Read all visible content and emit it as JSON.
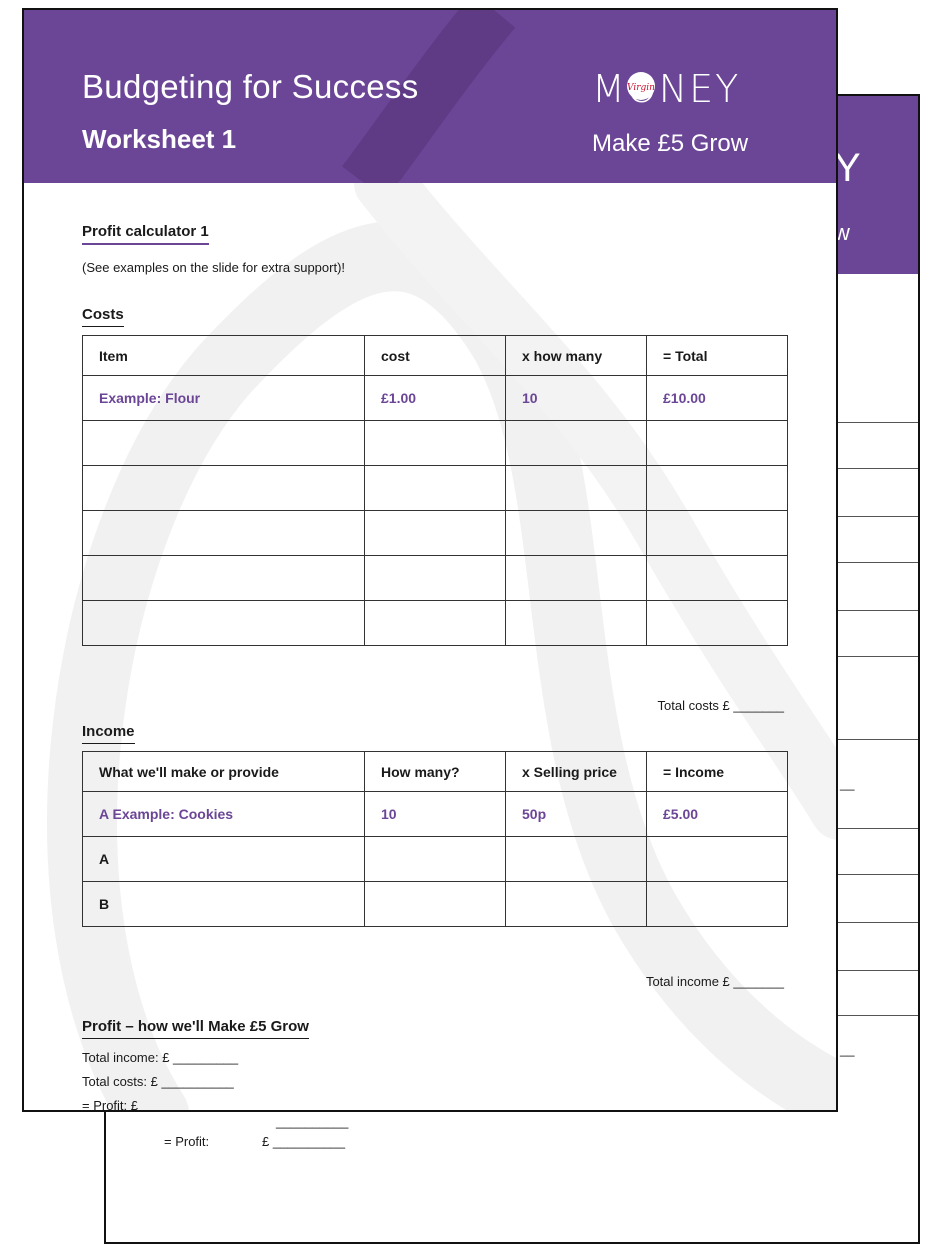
{
  "header": {
    "title": "Budgeting for Success",
    "subtitle": "Worksheet 1",
    "logo_text": "MONEY",
    "logo_badge": "Virgin",
    "tagline": "Make £5 Grow"
  },
  "back_page": {
    "logo_fragment": "Y",
    "tagline_fragment": "w",
    "profit_blank": "__________",
    "profit_label": "= Profit:",
    "profit_value": "£ __________",
    "dash_1": "__",
    "dash_2": "__"
  },
  "profit_calculator": {
    "heading": "Profit calculator 1",
    "note": "(See examples on the slide for extra support)!"
  },
  "costs": {
    "heading": "Costs",
    "columns": [
      "Item",
      "cost",
      "x how many",
      "= Total"
    ],
    "example": [
      "Example: Flour",
      "£1.00",
      "10",
      "£10.00"
    ],
    "total_label": "Total costs £  _______"
  },
  "income": {
    "heading": "Income",
    "columns": [
      "What we'll make or provide",
      "How many?",
      "x Selling price",
      "= Income"
    ],
    "example": [
      "A Example: Cookies",
      "10",
      "50p",
      "£5.00"
    ],
    "rows": [
      "A",
      "B"
    ],
    "total_label": "Total income £  _______"
  },
  "profit": {
    "heading": "Profit – how we'll Make £5 Grow",
    "lines": [
      "Total income: £ _________",
      "Total costs:  £ __________",
      "= Profit:      £ __________"
    ]
  },
  "colors": {
    "brand_purple": "#6b4596",
    "text": "#1a1a1a"
  }
}
